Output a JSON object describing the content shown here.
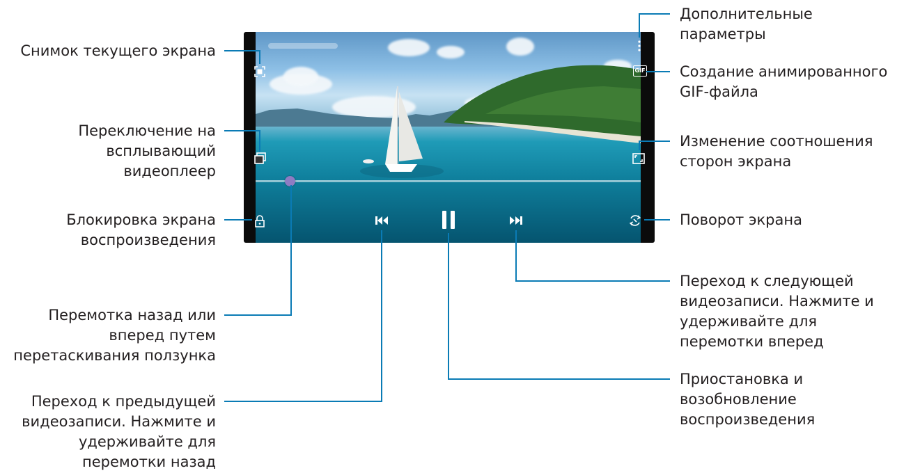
{
  "callouts": {
    "capture": "Снимок текущего экрана",
    "popup_player": "Переключение на\nвсплывающий\nвидеоплеер",
    "lock": "Блокировка экрана\nвоспроизведения",
    "seek": "Перемотка назад или\nвперед путем\nперетаскивания ползунка",
    "previous": "Переход к предыдущей\nвидеозаписи. Нажмите и\nудерживайте для\nперемотки назад",
    "more_options": "Дополнительные\nпараметры",
    "gif": "Создание анимированного\nGIF-файла",
    "ratio": "Изменение соотношения\nсторон экрана",
    "rotate": "Поворот экрана",
    "next": "Переход к следующей\nвидеозаписи. Нажмите и\nудерживайте для\nперемотки вперед",
    "pause": "Приостановка и\nвозобновление\nвоспроизведения"
  },
  "player": {
    "gif_badge": "GIF",
    "progress_fraction": 0.09
  },
  "icons": [
    "capture-icon",
    "popup-player-icon",
    "lock-icon",
    "more-options-icon",
    "gif-icon",
    "aspect-ratio-icon",
    "rotate-icon",
    "previous-icon",
    "pause-icon",
    "next-icon"
  ],
  "colors": {
    "leader_line": "#0a7bb5",
    "progress_thumb": "#8e7cc3",
    "text": "#231f20"
  }
}
